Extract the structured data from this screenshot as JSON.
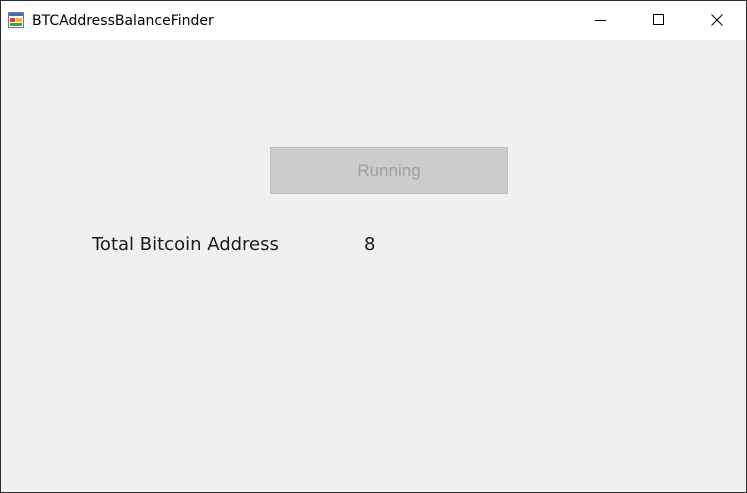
{
  "window": {
    "title": "BTCAddressBalanceFinder",
    "app_icon": "windows-form-icon",
    "controls": {
      "minimize_icon": "minimize-icon",
      "maximize_icon": "maximize-icon",
      "close_icon": "close-icon"
    }
  },
  "main": {
    "run_button_label": "Running",
    "run_button_enabled": false,
    "total_label": "Total Bitcoin Address",
    "total_value": "8"
  },
  "colors": {
    "window_background": "#f0f0f0",
    "titlebar_background": "#ffffff",
    "disabled_button_background": "#cccccc",
    "disabled_button_text": "#a0a0a0",
    "text": "#1a1a1a"
  }
}
